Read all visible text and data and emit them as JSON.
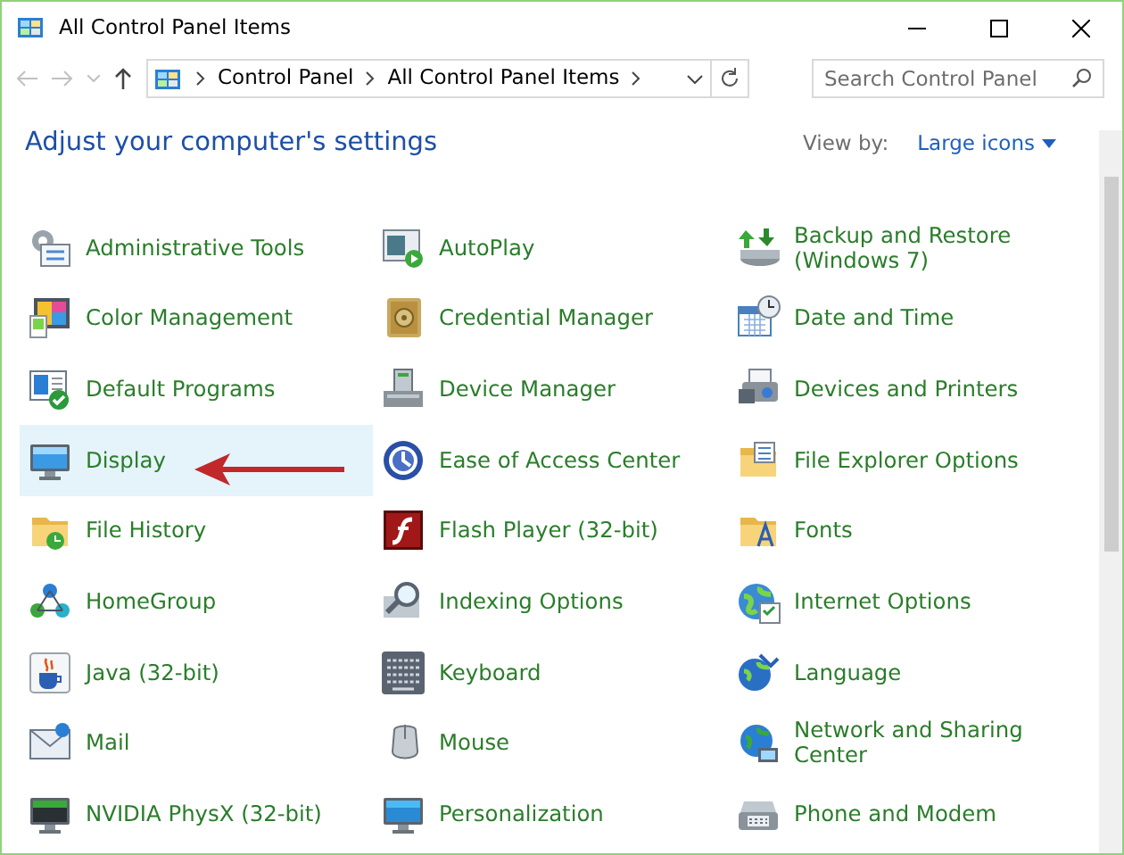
{
  "window": {
    "title": "All Control Panel Items"
  },
  "address_bar": {
    "path": [
      "Control Panel",
      "All Control Panel Items"
    ]
  },
  "search": {
    "placeholder": "Search Control Panel"
  },
  "heading": "Adjust your computer's settings",
  "view_by": {
    "label": "View by:",
    "value": "Large icons"
  },
  "items": [
    {
      "label": "Administrative Tools",
      "selected": false
    },
    {
      "label": "AutoPlay",
      "selected": false
    },
    {
      "label": "Backup and Restore (Windows 7)",
      "selected": false
    },
    {
      "label": "Color Management",
      "selected": false
    },
    {
      "label": "Credential Manager",
      "selected": false
    },
    {
      "label": "Date and Time",
      "selected": false
    },
    {
      "label": "Default Programs",
      "selected": false
    },
    {
      "label": "Device Manager",
      "selected": false
    },
    {
      "label": "Devices and Printers",
      "selected": false
    },
    {
      "label": "Display",
      "selected": true
    },
    {
      "label": "Ease of Access Center",
      "selected": false
    },
    {
      "label": "File Explorer Options",
      "selected": false
    },
    {
      "label": "File History",
      "selected": false
    },
    {
      "label": "Flash Player (32-bit)",
      "selected": false
    },
    {
      "label": "Fonts",
      "selected": false
    },
    {
      "label": "HomeGroup",
      "selected": false
    },
    {
      "label": "Indexing Options",
      "selected": false
    },
    {
      "label": "Internet Options",
      "selected": false
    },
    {
      "label": "Java (32-bit)",
      "selected": false
    },
    {
      "label": "Keyboard",
      "selected": false
    },
    {
      "label": "Language",
      "selected": false
    },
    {
      "label": "Mail",
      "selected": false
    },
    {
      "label": "Mouse",
      "selected": false
    },
    {
      "label": "Network and Sharing Center",
      "selected": false
    },
    {
      "label": "NVIDIA PhysX (32-bit)",
      "selected": false
    },
    {
      "label": "Personalization",
      "selected": false
    },
    {
      "label": "Phone and Modem",
      "selected": false
    }
  ]
}
